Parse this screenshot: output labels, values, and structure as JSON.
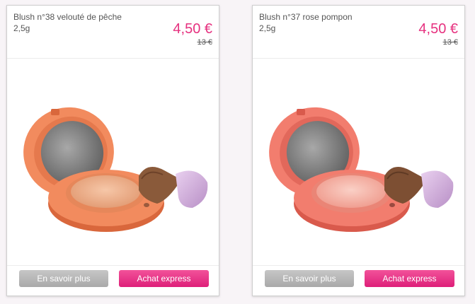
{
  "products": [
    {
      "title": "Blush n°38 velouté de pêche",
      "weight": "2,5g",
      "price": "4,50 €",
      "old_price": "13 €",
      "image_icon": "blush-compact-peach-image",
      "colors": {
        "case": "#f28b5e",
        "case_dark": "#d9673c",
        "pan": "#f1b089"
      },
      "more_label": "En savoir plus",
      "express_label": "Achat express"
    },
    {
      "title": "Blush n°37 rose pompon",
      "weight": "2,5g",
      "price": "4,50 €",
      "old_price": "13 €",
      "image_icon": "blush-compact-rose-image",
      "colors": {
        "case": "#f27d6e",
        "case_dark": "#d95a4c",
        "pan": "#f6b3a6"
      },
      "more_label": "En savoir plus",
      "express_label": "Achat express"
    }
  ],
  "colors": {
    "accent": "#e6317f",
    "button_grey": "#b3b3b3",
    "button_pink": "#e92a84"
  }
}
